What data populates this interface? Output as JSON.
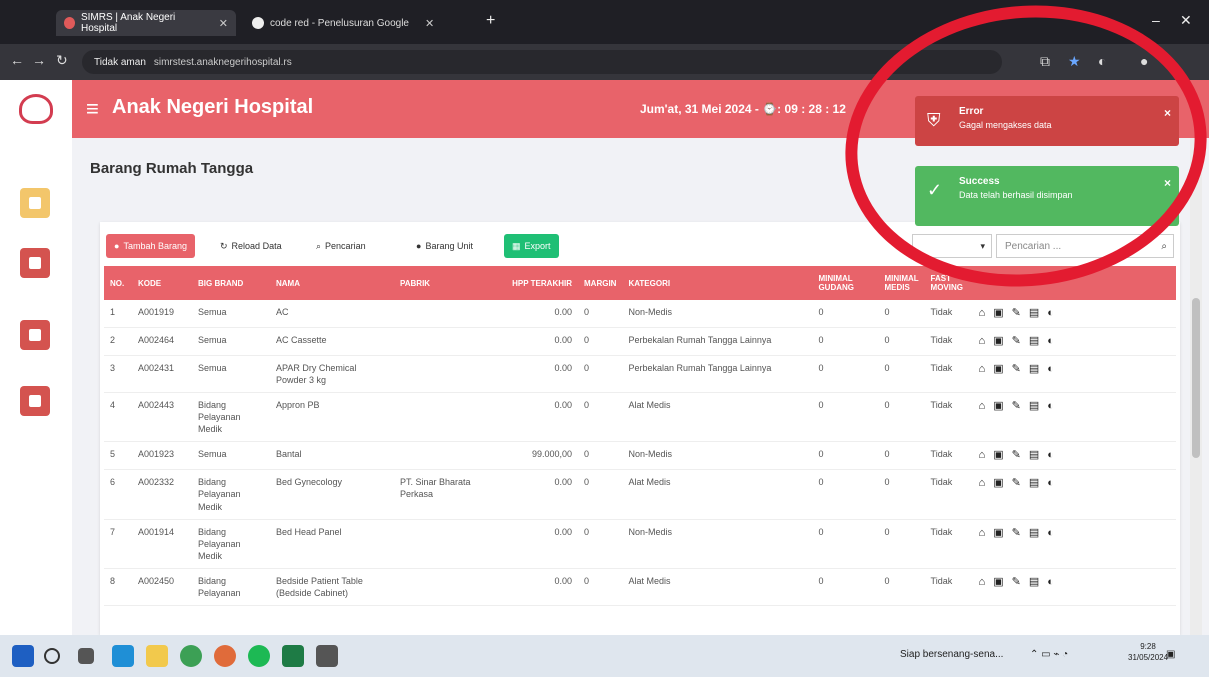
{
  "browser": {
    "tabs": [
      {
        "label": "SIMRS | Anak Negeri Hospital"
      },
      {
        "label": "code red - Penelusuran Google"
      }
    ],
    "address": {
      "security": "Tidak aman",
      "url": "simrstest.anaknegerihospital.rs"
    }
  },
  "header": {
    "brand": "Anak Negeri Hospital",
    "datetime": "Jum'at, 31 Mei 2024 - ⌚: 09 : 28 : 12"
  },
  "page": {
    "title": "Barang Rumah Tangga"
  },
  "toolbar": {
    "add_label": "Tambah Barang",
    "reload_label": "Reload Data",
    "search_label": "Pencarian",
    "unit_label": "Barang Unit",
    "export_label": "Export",
    "search_placeholder": "Pencarian ..."
  },
  "table": {
    "headers": [
      "NO.",
      "KODE",
      "BIG BRAND",
      "NAMA",
      "PABRIK",
      "HPP TERAKHIR",
      "MARGIN",
      "KATEGORI",
      "MINIMAL GUDANG",
      "MINIMAL MEDIS",
      "FAST MOVING"
    ],
    "rows": [
      {
        "no": "1",
        "kode": "A001919",
        "brand": "Semua",
        "nama": "AC",
        "pabrik": "",
        "hpp": "0.00",
        "margin": "0",
        "kategori": "Non-Medis",
        "min_gudang": "0",
        "min_medis": "0",
        "fast": "Tidak"
      },
      {
        "no": "2",
        "kode": "A002464",
        "brand": "Semua",
        "nama": "AC Cassette",
        "pabrik": "",
        "hpp": "0.00",
        "margin": "0",
        "kategori": "Perbekalan Rumah Tangga Lainnya",
        "min_gudang": "0",
        "min_medis": "0",
        "fast": "Tidak"
      },
      {
        "no": "3",
        "kode": "A002431",
        "brand": "Semua",
        "nama": "APAR Dry Chemical Powder 3 kg",
        "pabrik": "",
        "hpp": "0.00",
        "margin": "0",
        "kategori": "Perbekalan Rumah Tangga Lainnya",
        "min_gudang": "0",
        "min_medis": "0",
        "fast": "Tidak"
      },
      {
        "no": "4",
        "kode": "A002443",
        "brand": "Bidang Pelayanan Medik",
        "nama": "Appron PB",
        "pabrik": "",
        "hpp": "0.00",
        "margin": "0",
        "kategori": "Alat Medis",
        "min_gudang": "0",
        "min_medis": "0",
        "fast": "Tidak"
      },
      {
        "no": "5",
        "kode": "A001923",
        "brand": "Semua",
        "nama": "Bantal",
        "pabrik": "",
        "hpp": "99.000,00",
        "margin": "0",
        "kategori": "Non-Medis",
        "min_gudang": "0",
        "min_medis": "0",
        "fast": "Tidak"
      },
      {
        "no": "6",
        "kode": "A002332",
        "brand": "Bidang Pelayanan Medik",
        "nama": "Bed Gynecology",
        "pabrik": "PT. Sinar Bharata Perkasa",
        "hpp": "0.00",
        "margin": "0",
        "kategori": "Alat Medis",
        "min_gudang": "0",
        "min_medis": "0",
        "fast": "Tidak"
      },
      {
        "no": "7",
        "kode": "A001914",
        "brand": "Bidang Pelayanan Medik",
        "nama": "Bed Head Panel",
        "pabrik": "",
        "hpp": "0.00",
        "margin": "0",
        "kategori": "Non-Medis",
        "min_gudang": "0",
        "min_medis": "0",
        "fast": "Tidak"
      },
      {
        "no": "8",
        "kode": "A002450",
        "brand": "Bidang Pelayanan",
        "nama": "Bedside Patient Table (Bedside Cabinet)",
        "pabrik": "",
        "hpp": "0.00",
        "margin": "0",
        "kategori": "Alat Medis",
        "min_gudang": "0",
        "min_medis": "0",
        "fast": "Tidak"
      }
    ]
  },
  "toasts": {
    "error": {
      "title": "Error",
      "message": "Gagal mengakses data"
    },
    "success": {
      "title": "Success",
      "message": "Data telah berhasil disimpan"
    }
  },
  "taskbar": {
    "tray_text": "Siap bersenang-sena...",
    "time": "9:28",
    "date": "31/05/2024"
  },
  "colors": {
    "header": "#e8636a",
    "export": "#1fbf75",
    "error": "#cc4444",
    "success": "#52b860",
    "annotation": "#e31b30"
  }
}
